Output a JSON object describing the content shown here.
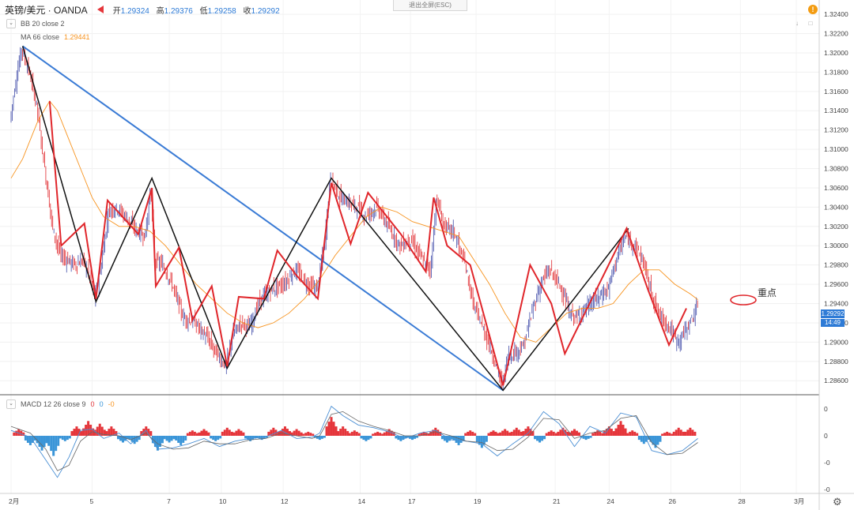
{
  "header": {
    "symbol": "英镑/美元 · OANDA",
    "open_label": "开",
    "open": "1.29324",
    "high_label": "高",
    "high": "1.29376",
    "low_label": "低",
    "low": "1.29258",
    "close_label": "收",
    "close": "1.29292",
    "exit_fullscreen": "退出全屏(ESC)"
  },
  "indicators": {
    "bb": "BB 20 close 2",
    "ma": "MA 66 close",
    "ma_value": "1.29441",
    "macd": "MACD 12 26 close 9",
    "macd_v1": "0",
    "macd_v2": "0",
    "macd_v3": "-0"
  },
  "annotation": {
    "focus": "重点"
  },
  "current": {
    "price": "1.29292",
    "countdown": "14:49"
  },
  "colors": {
    "zigzag_black": "#111111",
    "zigzag_red": "#e0262b",
    "trendline": "#3a7bd5",
    "ma": "#f7931e",
    "candle_up": "#3f4aa8",
    "candle_down": "#e0262b",
    "macd_pos": "#e5363b",
    "macd_neg": "#3a95d8",
    "price_tag": "#2e7bd6"
  },
  "icons": {
    "alert": "alert-icon",
    "settings": "gear-icon",
    "collapse": "chevron-down-icon"
  },
  "chart_data": {
    "type": "line",
    "title": "",
    "x_ticks": [
      "2月",
      "5",
      "7",
      "10",
      "12",
      "14",
      "17",
      "19",
      "21",
      "24",
      "26",
      "28",
      "3月"
    ],
    "y_ticks": [
      "1.32400",
      "1.32200",
      "1.32000",
      "1.31800",
      "1.31600",
      "1.31400",
      "1.31200",
      "1.31000",
      "1.30800",
      "1.30600",
      "1.30400",
      "1.30200",
      "1.30000",
      "1.29800",
      "1.29600",
      "1.29400",
      "1.29200",
      "1.29000",
      "1.28800",
      "1.28600"
    ],
    "ylim": [
      1.2852,
      1.3245
    ],
    "macd_ticks": [
      "0",
      "0",
      "-0",
      "-0"
    ],
    "price_path": [
      [
        0,
        1.313
      ],
      [
        0.15,
        1.317
      ],
      [
        0.3,
        1.3205
      ],
      [
        0.5,
        1.318
      ],
      [
        0.7,
        1.3145
      ],
      [
        0.9,
        1.308
      ],
      [
        1.1,
        1.302
      ],
      [
        1.3,
        1.299
      ],
      [
        1.5,
        1.2985
      ],
      [
        1.7,
        1.298
      ],
      [
        1.9,
        1.2985
      ],
      [
        2.05,
        1.297
      ],
      [
        2.2,
        1.2945
      ],
      [
        2.35,
        1.2975
      ],
      [
        2.55,
        1.3035
      ],
      [
        2.75,
        1.304
      ],
      [
        3.0,
        1.303
      ],
      [
        3.3,
        1.3015
      ],
      [
        3.5,
        1.301
      ],
      [
        3.65,
        1.306
      ],
      [
        3.75,
        1.2985
      ],
      [
        3.95,
        1.298
      ],
      [
        4.2,
        1.296
      ],
      [
        4.5,
        1.2925
      ],
      [
        4.8,
        1.292
      ],
      [
        5.1,
        1.2905
      ],
      [
        5.4,
        1.2885
      ],
      [
        5.6,
        1.2875
      ],
      [
        5.8,
        1.291
      ],
      [
        6.0,
        1.292
      ],
      [
        6.2,
        1.2915
      ],
      [
        6.5,
        1.2945
      ],
      [
        6.8,
        1.2955
      ],
      [
        7.1,
        1.296
      ],
      [
        7.4,
        1.2975
      ],
      [
        7.7,
        1.296
      ],
      [
        7.95,
        1.2955
      ],
      [
        8.15,
        1.3
      ],
      [
        8.3,
        1.307
      ],
      [
        8.55,
        1.305
      ],
      [
        8.75,
        1.3045
      ],
      [
        9.0,
        1.304
      ],
      [
        9.2,
        1.303
      ],
      [
        9.5,
        1.304
      ],
      [
        9.8,
        1.302
      ],
      [
        10.1,
        1.3
      ],
      [
        10.4,
        1.3005
      ],
      [
        10.7,
        1.2985
      ],
      [
        10.9,
        1.2975
      ],
      [
        11.05,
        1.305
      ],
      [
        11.25,
        1.302
      ],
      [
        11.5,
        1.3015
      ],
      [
        11.8,
        1.298
      ],
      [
        12.0,
        1.294
      ],
      [
        12.2,
        1.292
      ],
      [
        12.4,
        1.29
      ],
      [
        12.6,
        1.2875
      ],
      [
        12.75,
        1.2855
      ],
      [
        12.9,
        1.2885
      ],
      [
        13.1,
        1.289
      ],
      [
        13.3,
        1.2895
      ],
      [
        13.55,
        1.2935
      ],
      [
        13.8,
        1.2965
      ],
      [
        14.0,
        1.2975
      ],
      [
        14.3,
        1.2955
      ],
      [
        14.5,
        1.293
      ],
      [
        14.7,
        1.2925
      ],
      [
        14.9,
        1.2935
      ],
      [
        15.2,
        1.2945
      ],
      [
        15.5,
        1.2955
      ],
      [
        15.7,
        1.2985
      ],
      [
        15.95,
        1.301
      ],
      [
        16.2,
        1.3
      ],
      [
        16.4,
        1.2985
      ],
      [
        16.6,
        1.2955
      ],
      [
        16.8,
        1.293
      ],
      [
        17.1,
        1.2915
      ],
      [
        17.3,
        1.29
      ],
      [
        17.55,
        1.2915
      ],
      [
        17.8,
        1.2935
      ]
    ],
    "ma_path": [
      [
        0,
        1.307
      ],
      [
        0.3,
        1.309
      ],
      [
        0.7,
        1.313
      ],
      [
        1.0,
        1.315
      ],
      [
        1.2,
        1.314
      ],
      [
        1.5,
        1.311
      ],
      [
        1.8,
        1.308
      ],
      [
        2.1,
        1.305
      ],
      [
        2.4,
        1.303
      ],
      [
        2.8,
        1.302
      ],
      [
        3.2,
        1.302
      ],
      [
        3.6,
        1.3015
      ],
      [
        4.0,
        1.3
      ],
      [
        4.4,
        1.298
      ],
      [
        4.8,
        1.296
      ],
      [
        5.2,
        1.2945
      ],
      [
        5.6,
        1.293
      ],
      [
        6.0,
        1.292
      ],
      [
        6.4,
        1.2915
      ],
      [
        6.8,
        1.292
      ],
      [
        7.2,
        1.293
      ],
      [
        7.6,
        1.2945
      ],
      [
        8.0,
        1.2965
      ],
      [
        8.4,
        1.299
      ],
      [
        8.8,
        1.301
      ],
      [
        9.2,
        1.303
      ],
      [
        9.6,
        1.304
      ],
      [
        10.0,
        1.3035
      ],
      [
        10.4,
        1.3025
      ],
      [
        10.8,
        1.302
      ],
      [
        11.2,
        1.3015
      ],
      [
        11.6,
        1.301
      ],
      [
        12.0,
        1.2985
      ],
      [
        12.4,
        1.296
      ],
      [
        12.8,
        1.293
      ],
      [
        13.2,
        1.2905
      ],
      [
        13.6,
        1.29
      ],
      [
        14.0,
        1.2915
      ],
      [
        14.4,
        1.293
      ],
      [
        14.8,
        1.2935
      ],
      [
        15.2,
        1.2935
      ],
      [
        15.6,
        1.294
      ],
      [
        16.0,
        1.296
      ],
      [
        16.4,
        1.2975
      ],
      [
        16.8,
        1.2975
      ],
      [
        17.2,
        1.296
      ],
      [
        17.6,
        1.295
      ],
      [
        17.8,
        1.2944
      ]
    ],
    "black_zigzag": [
      [
        0.3,
        1.3207
      ],
      [
        2.2,
        1.2942
      ],
      [
        3.65,
        1.307
      ],
      [
        5.6,
        1.2873
      ],
      [
        8.3,
        1.307
      ],
      [
        12.75,
        1.285
      ],
      [
        16.0,
        1.3018
      ]
    ],
    "blue_trendline": [
      [
        0.3,
        1.3207
      ],
      [
        12.75,
        1.285
      ]
    ],
    "red_zigzag": [
      [
        1.0,
        1.315
      ],
      [
        1.3,
        1.3
      ],
      [
        1.9,
        1.3023
      ],
      [
        2.2,
        1.2945
      ],
      [
        2.5,
        1.3047
      ],
      [
        3.3,
        1.3012
      ],
      [
        3.65,
        1.306
      ],
      [
        3.75,
        1.2958
      ],
      [
        4.35,
        1.2998
      ],
      [
        4.7,
        1.2923
      ],
      [
        5.2,
        1.2958
      ],
      [
        5.6,
        1.2875
      ],
      [
        5.9,
        1.2947
      ],
      [
        6.55,
        1.2945
      ],
      [
        6.9,
        1.2995
      ],
      [
        7.4,
        1.2969
      ],
      [
        7.95,
        1.2945
      ],
      [
        8.3,
        1.3065
      ],
      [
        8.8,
        1.3002
      ],
      [
        9.25,
        1.3055
      ],
      [
        10.1,
        1.3012
      ],
      [
        10.75,
        1.2973
      ],
      [
        10.95,
        1.305
      ],
      [
        11.3,
        1.3
      ],
      [
        11.9,
        1.298
      ],
      [
        12.75,
        1.2855
      ],
      [
        13.45,
        1.298
      ],
      [
        14.0,
        1.294
      ],
      [
        14.35,
        1.2888
      ],
      [
        15.95,
        1.3018
      ],
      [
        16.5,
        1.2955
      ],
      [
        17.05,
        1.2897
      ],
      [
        17.5,
        1.2935
      ]
    ],
    "macd_hist": [
      [
        0.2,
        0.25
      ],
      [
        0.5,
        -0.35
      ],
      [
        0.8,
        -0.55
      ],
      [
        1.1,
        -0.75
      ],
      [
        1.4,
        -0.2
      ],
      [
        1.7,
        0.35
      ],
      [
        2.0,
        0.55
      ],
      [
        2.3,
        0.45
      ],
      [
        2.6,
        0.35
      ],
      [
        2.9,
        -0.25
      ],
      [
        3.2,
        -0.3
      ],
      [
        3.5,
        0.35
      ],
      [
        3.8,
        -0.55
      ],
      [
        4.1,
        -0.25
      ],
      [
        4.4,
        -0.35
      ],
      [
        4.7,
        0.2
      ],
      [
        5.0,
        0.25
      ],
      [
        5.3,
        -0.2
      ],
      [
        5.6,
        0.3
      ],
      [
        5.9,
        0.25
      ],
      [
        6.2,
        -0.2
      ],
      [
        6.5,
        -0.15
      ],
      [
        6.8,
        0.3
      ],
      [
        7.1,
        0.35
      ],
      [
        7.4,
        0.25
      ],
      [
        7.7,
        0.15
      ],
      [
        8.0,
        -0.15
      ],
      [
        8.3,
        0.7
      ],
      [
        8.6,
        0.35
      ],
      [
        8.9,
        0.2
      ],
      [
        9.2,
        -0.2
      ],
      [
        9.5,
        0.15
      ],
      [
        9.8,
        0.25
      ],
      [
        10.1,
        -0.2
      ],
      [
        10.4,
        -0.15
      ],
      [
        10.7,
        0.15
      ],
      [
        11.0,
        0.3
      ],
      [
        11.3,
        -0.25
      ],
      [
        11.6,
        -0.35
      ],
      [
        11.9,
        0.2
      ],
      [
        12.2,
        -0.45
      ],
      [
        12.5,
        0.2
      ],
      [
        12.8,
        0.25
      ],
      [
        13.1,
        0.3
      ],
      [
        13.4,
        0.35
      ],
      [
        13.7,
        -0.25
      ],
      [
        14.0,
        0.2
      ],
      [
        14.3,
        0.3
      ],
      [
        14.6,
        0.25
      ],
      [
        14.9,
        -0.15
      ],
      [
        15.2,
        0.2
      ],
      [
        15.5,
        0.35
      ],
      [
        15.8,
        0.55
      ],
      [
        16.1,
        0.2
      ],
      [
        16.4,
        -0.3
      ],
      [
        16.7,
        -0.45
      ],
      [
        17.0,
        0.15
      ],
      [
        17.3,
        0.3
      ],
      [
        17.6,
        0.3
      ]
    ],
    "macd_line": [
      [
        0,
        0.2
      ],
      [
        0.5,
        -0.05
      ],
      [
        0.9,
        -0.9
      ],
      [
        1.2,
        -1.55
      ],
      [
        1.5,
        -0.8
      ],
      [
        1.8,
        0.2
      ],
      [
        2.1,
        0.25
      ],
      [
        2.4,
        -0.1
      ],
      [
        2.8,
        0.1
      ],
      [
        3.1,
        -0.3
      ],
      [
        3.5,
        0.2
      ],
      [
        3.8,
        -0.5
      ],
      [
        4.2,
        -0.45
      ],
      [
        4.6,
        -0.3
      ],
      [
        5.0,
        -0.1
      ],
      [
        5.4,
        -0.4
      ],
      [
        5.8,
        -0.2
      ],
      [
        6.2,
        -0.1
      ],
      [
        6.6,
        -0.05
      ],
      [
        7.0,
        0.2
      ],
      [
        7.4,
        -0.1
      ],
      [
        7.8,
        -0.05
      ],
      [
        8.0,
        0.1
      ],
      [
        8.3,
        1.1
      ],
      [
        8.6,
        0.75
      ],
      [
        9.0,
        0.4
      ],
      [
        9.4,
        0.3
      ],
      [
        9.8,
        0.15
      ],
      [
        10.2,
        -0.1
      ],
      [
        10.6,
        0.1
      ],
      [
        11.0,
        0.2
      ],
      [
        11.4,
        -0.15
      ],
      [
        11.8,
        -0.2
      ],
      [
        12.2,
        -0.3
      ],
      [
        12.6,
        -0.75
      ],
      [
        13.0,
        -0.3
      ],
      [
        13.4,
        0.1
      ],
      [
        13.8,
        0.9
      ],
      [
        14.2,
        0.45
      ],
      [
        14.6,
        -0.4
      ],
      [
        15.0,
        0.35
      ],
      [
        15.4,
        0.1
      ],
      [
        15.8,
        0.85
      ],
      [
        16.2,
        0.7
      ],
      [
        16.6,
        -0.55
      ],
      [
        17.0,
        -0.7
      ],
      [
        17.4,
        -0.55
      ],
      [
        17.8,
        -0.1
      ]
    ],
    "macd_signal": [
      [
        0,
        0.35
      ],
      [
        0.5,
        0.1
      ],
      [
        0.9,
        -0.5
      ],
      [
        1.2,
        -1.3
      ],
      [
        1.5,
        -1.1
      ],
      [
        1.8,
        -0.2
      ],
      [
        2.1,
        0.15
      ],
      [
        2.4,
        0.05
      ],
      [
        2.8,
        0.0
      ],
      [
        3.1,
        -0.15
      ],
      [
        3.5,
        0.1
      ],
      [
        3.8,
        -0.3
      ],
      [
        4.2,
        -0.5
      ],
      [
        4.6,
        -0.45
      ],
      [
        5.0,
        -0.2
      ],
      [
        5.4,
        -0.3
      ],
      [
        5.8,
        -0.3
      ],
      [
        6.2,
        -0.15
      ],
      [
        6.6,
        -0.1
      ],
      [
        7.0,
        0.1
      ],
      [
        7.4,
        0.0
      ],
      [
        7.8,
        -0.1
      ],
      [
        8.0,
        0.0
      ],
      [
        8.3,
        0.8
      ],
      [
        8.6,
        0.9
      ],
      [
        9.0,
        0.55
      ],
      [
        9.4,
        0.35
      ],
      [
        9.8,
        0.2
      ],
      [
        10.2,
        0.0
      ],
      [
        10.6,
        0.0
      ],
      [
        11.0,
        0.15
      ],
      [
        11.4,
        0.0
      ],
      [
        11.8,
        -0.2
      ],
      [
        12.2,
        -0.25
      ],
      [
        12.6,
        -0.55
      ],
      [
        13.0,
        -0.5
      ],
      [
        13.4,
        -0.05
      ],
      [
        13.8,
        0.65
      ],
      [
        14.2,
        0.6
      ],
      [
        14.6,
        -0.1
      ],
      [
        15.0,
        0.1
      ],
      [
        15.4,
        0.2
      ],
      [
        15.8,
        0.65
      ],
      [
        16.2,
        0.75
      ],
      [
        16.6,
        -0.25
      ],
      [
        17.0,
        -0.7
      ],
      [
        17.4,
        -0.65
      ],
      [
        17.8,
        -0.25
      ]
    ]
  }
}
